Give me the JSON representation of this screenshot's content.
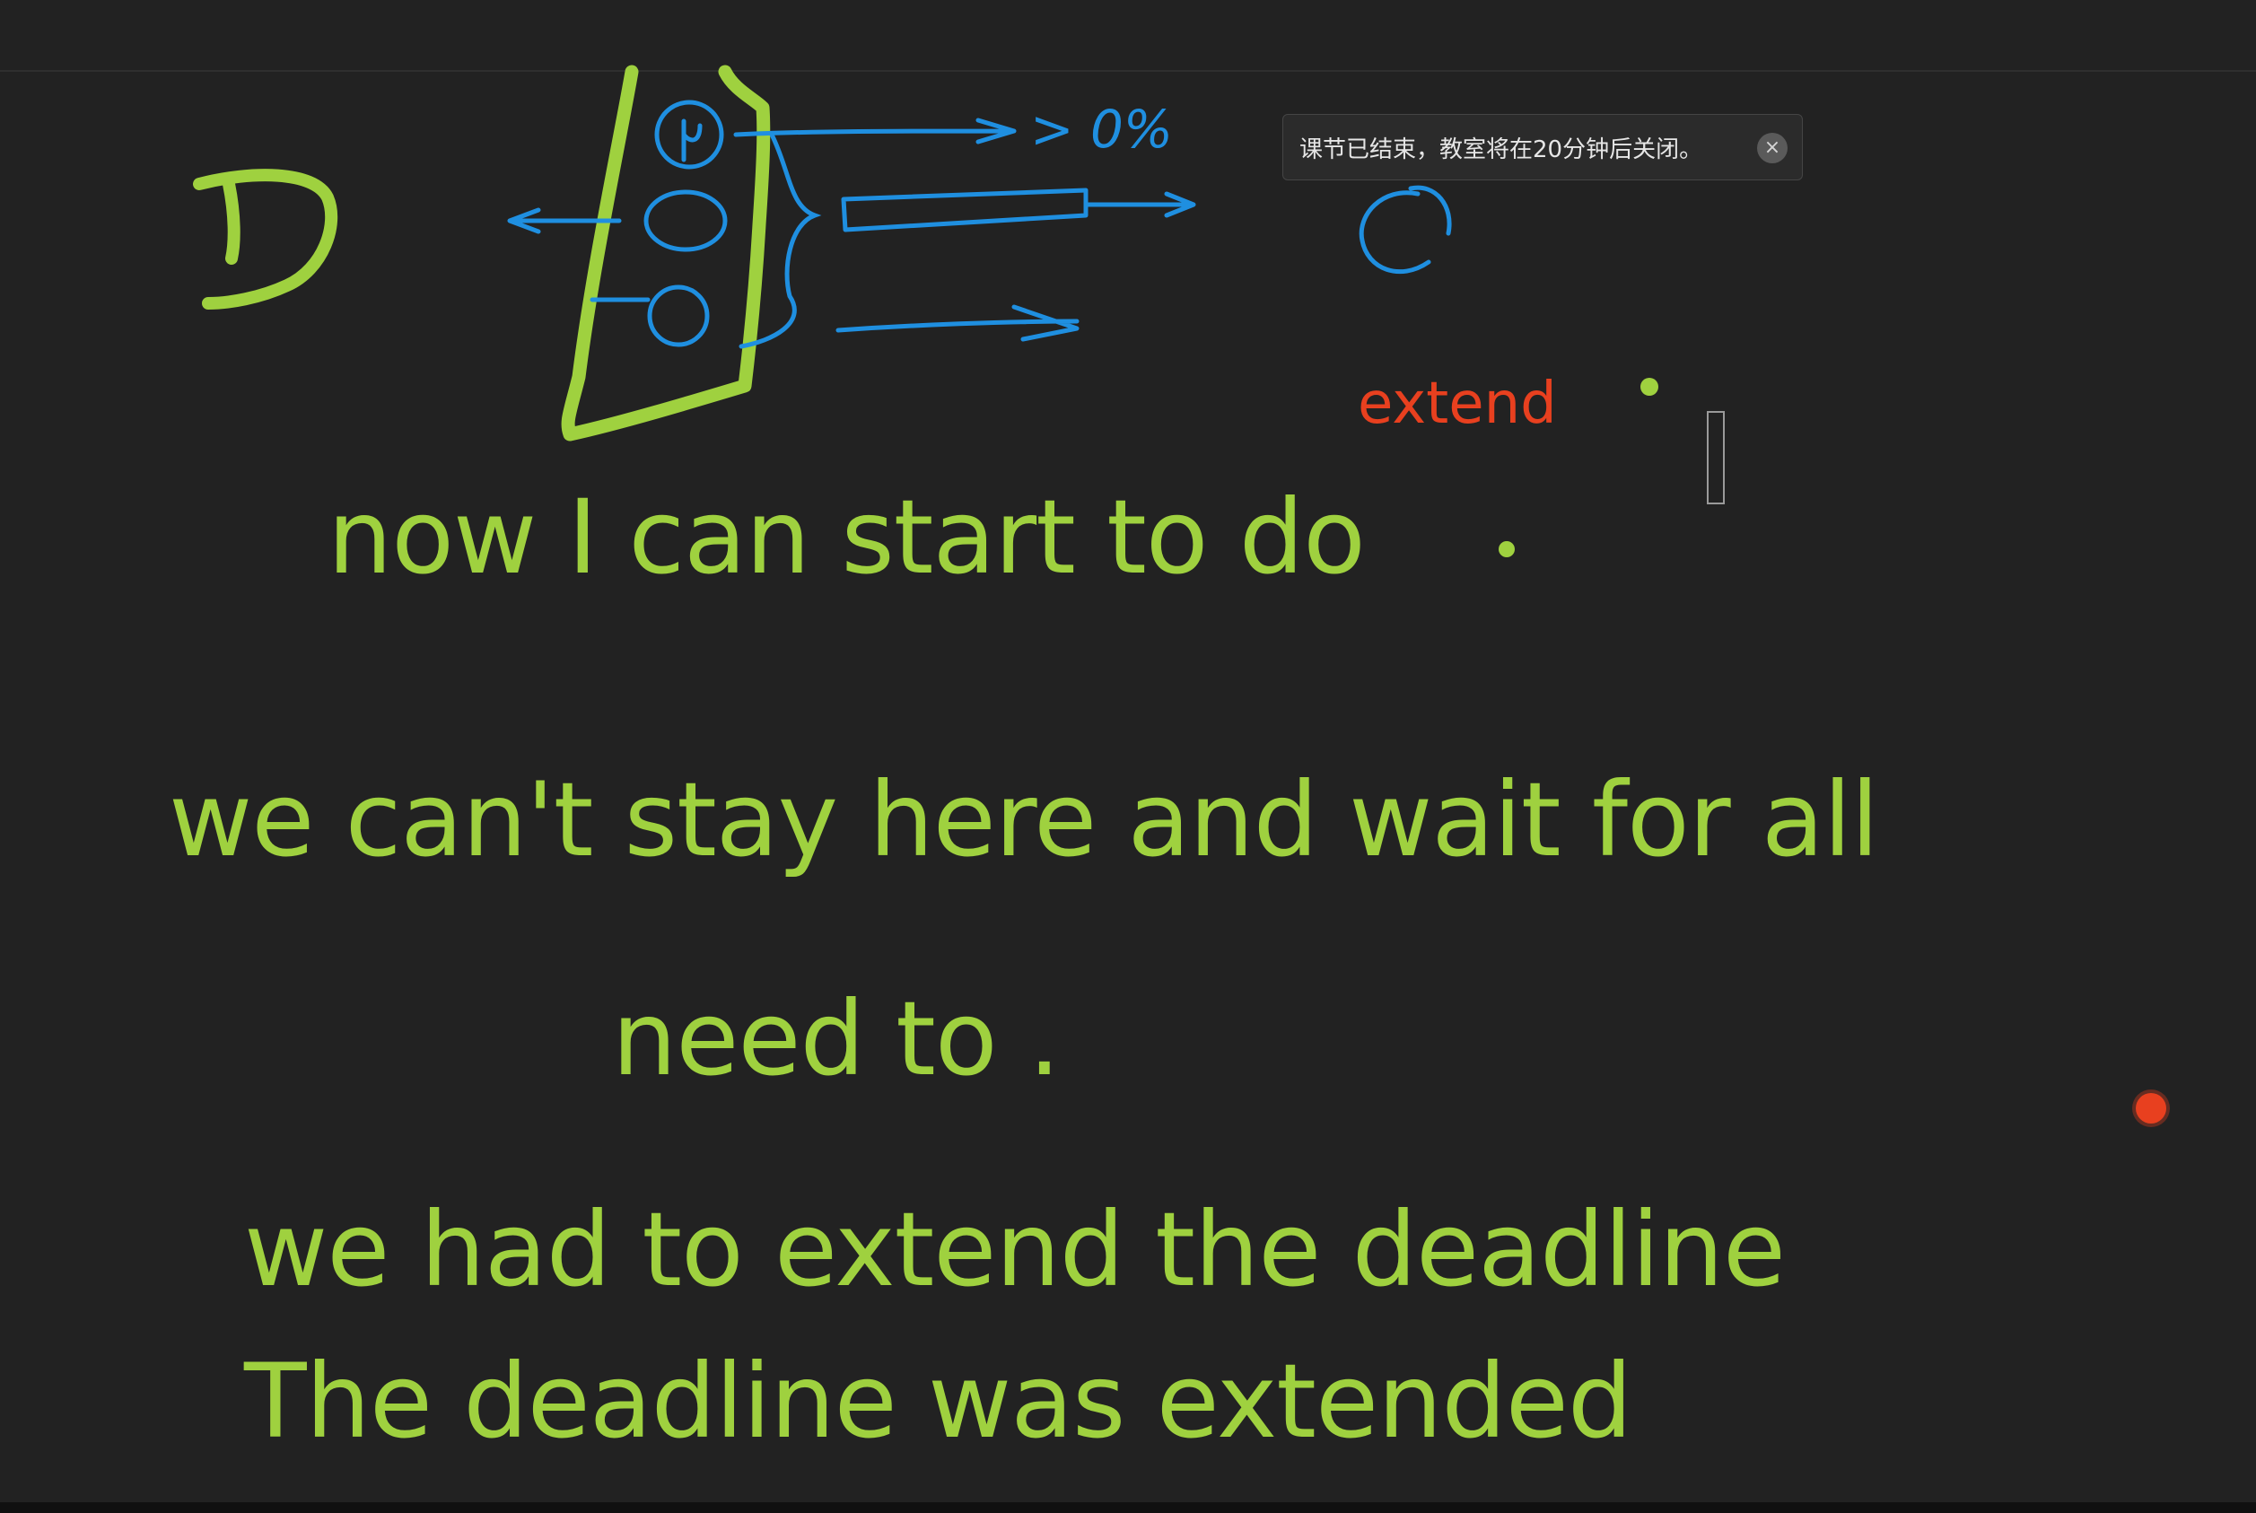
{
  "toast": {
    "message": "课节已结束，教室将在20分钟后关闭。",
    "close_glyph": "×"
  },
  "board": {
    "annotation_word": "extend",
    "sketch_percent_label": "> 0%",
    "lines": [
      "now I can start to do",
      "we can't stay here and wait for all",
      "need  to .",
      "we had to extend the deadline",
      "The deadline was extended"
    ]
  },
  "colors": {
    "background": "#222222",
    "green_ink": "#9fd13f",
    "blue_ink": "#1f8fe0",
    "red_ink": "#e8401f"
  }
}
